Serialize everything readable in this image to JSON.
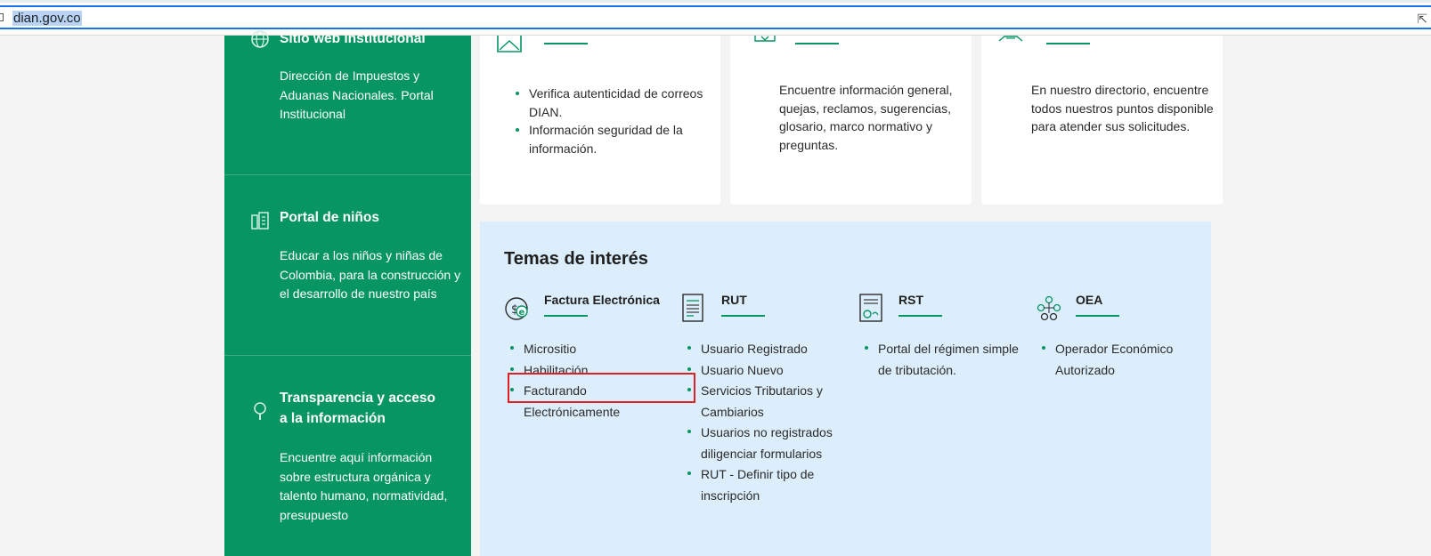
{
  "browser": {
    "url": "dian.gov.co"
  },
  "sidebar": {
    "sections": [
      {
        "title": "Sitio web institucional",
        "description": "Dirección de Impuestos y Aduanas Nacionales. Portal Institucional",
        "icon": "globe-icon"
      },
      {
        "title": "Portal de niños",
        "description": "Educar a los niños y niñas de Colombia, para la construcción y el desarrollo de nuestro país",
        "icon": "kids-portal-icon"
      },
      {
        "title_line1": "Transparencia y acceso",
        "title_line2": "a la información",
        "description": "Encuentre aquí información sobre estructura orgánica y talento humano, normatividad, presupuesto",
        "icon": "magnifier-icon"
      }
    ]
  },
  "cards": {
    "security": {
      "items": [
        "Verifica autenticidad de correos DIAN.",
        "Información seguridad de la información."
      ]
    },
    "help": {
      "description": "Encuentre información general, quejas, reclamos, sugerencias, glosario, marco normativo y preguntas."
    },
    "directory": {
      "description": "En nuestro directorio, encuentre todos nuestros puntos disponible para atender sus solicitudes."
    }
  },
  "temas": {
    "title": "Temas de interés",
    "columns": [
      {
        "title": "Factura Electrónica",
        "icon": "invoice-icon",
        "items": [
          "Micrositio",
          "Habilitación",
          "Facturando Electrónicamente"
        ]
      },
      {
        "title": "RUT",
        "icon": "document-icon",
        "items": [
          "Usuario Registrado",
          "Usuario Nuevo",
          "Servicios Tributarios y Cambiarios",
          "Usuarios no registrados diligenciar formularios",
          "RUT - Definir tipo de inscripción"
        ]
      },
      {
        "title": "RST",
        "icon": "certificate-icon",
        "items": [
          "Portal del régimen simple de tributación."
        ]
      },
      {
        "title": "OEA",
        "icon": "network-icon",
        "items": [
          "Operador Económico Autorizado"
        ]
      }
    ]
  },
  "colors": {
    "green": "#079561",
    "panel": "#dcedfb",
    "highlight": "#e01e25"
  }
}
